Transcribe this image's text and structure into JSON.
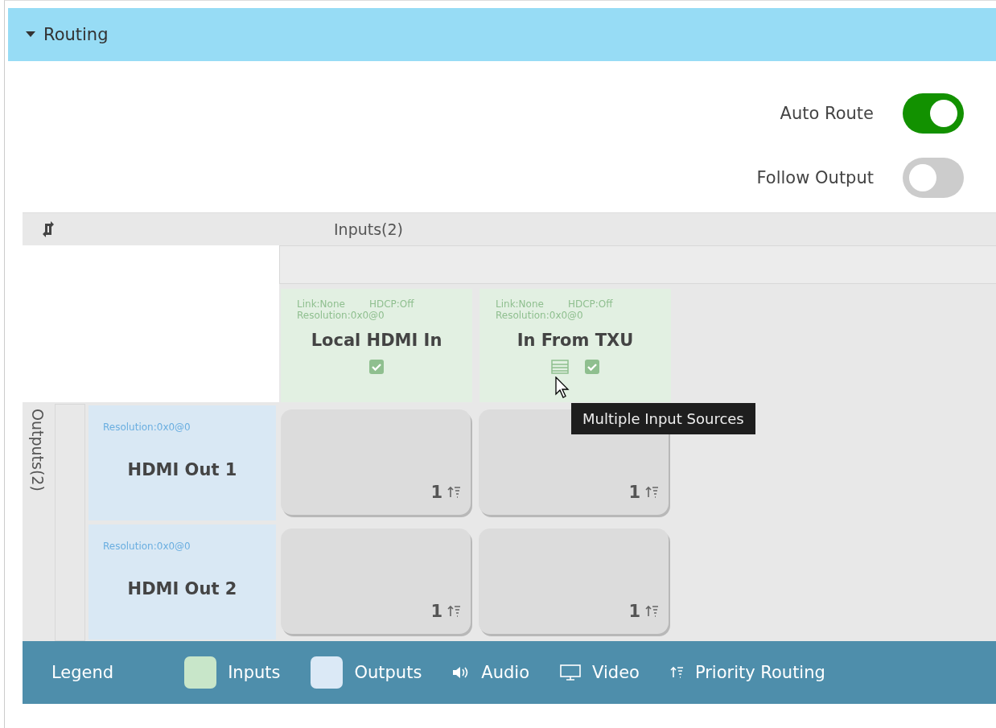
{
  "section": {
    "title": "Routing",
    "expanded": true
  },
  "toggles": [
    {
      "label": "Auto Route",
      "on": true
    },
    {
      "label": "Follow Output",
      "on": false
    }
  ],
  "matrix": {
    "inputs_label": "Inputs(2)",
    "outputs_label": "Outputs(2)",
    "inputs": [
      {
        "link": "Link:None",
        "hdcp": "HDCP:Off",
        "resolution": "Resolution:0x0@0",
        "name": "Local HDMI In",
        "checked": true,
        "multiple_sources": false
      },
      {
        "link": "Link:None",
        "hdcp": "HDCP:Off",
        "resolution": "Resolution:0x0@0",
        "name": "In From TXU",
        "checked": true,
        "multiple_sources": true
      }
    ],
    "outputs": [
      {
        "resolution": "Resolution:0x0@0",
        "name": "HDMI Out 1",
        "cells": [
          {
            "priority": "1"
          },
          {
            "priority": "1"
          }
        ]
      },
      {
        "resolution": "Resolution:0x0@0",
        "name": "HDMI Out 2",
        "cells": [
          {
            "priority": "1"
          },
          {
            "priority": "1"
          }
        ]
      }
    ]
  },
  "tooltip": "Multiple Input Sources",
  "legend": {
    "title": "Legend",
    "items": [
      {
        "kind": "inputs",
        "label": "Inputs"
      },
      {
        "kind": "outputs",
        "label": "Outputs"
      },
      {
        "kind": "audio",
        "label": "Audio"
      },
      {
        "kind": "video",
        "label": "Video"
      },
      {
        "kind": "priority",
        "label": "Priority Routing"
      }
    ]
  }
}
